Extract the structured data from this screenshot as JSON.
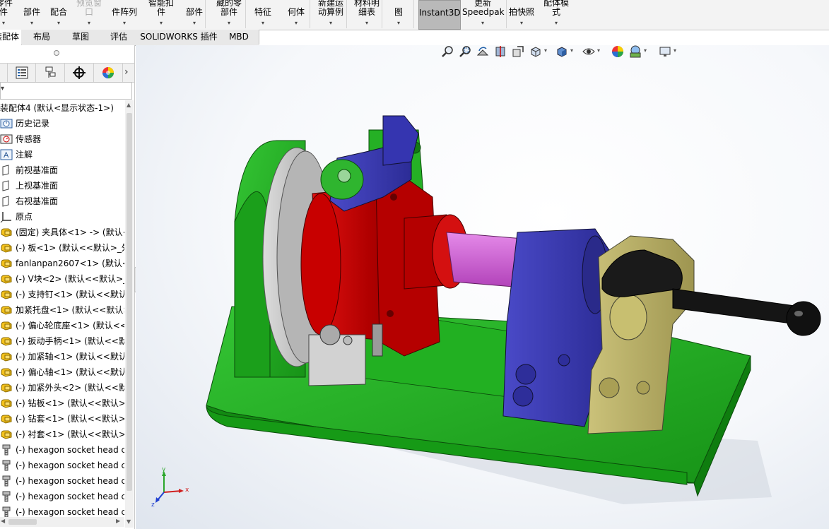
{
  "ribbon": {
    "buttons": [
      {
        "label": "零件\n件"
      },
      {
        "label": "部件"
      },
      {
        "label": "配合"
      },
      {
        "label": "零部件\n预览窗\n口",
        "dim": true
      },
      {
        "label": "件阵列"
      },
      {
        "label": "智能扣\n件"
      },
      {
        "label": "部件"
      },
      {
        "label": "显示隐\n藏的零\n部件"
      },
      {
        "label": "特征"
      },
      {
        "label": "何体"
      },
      {
        "label": "新建运\n动算例"
      },
      {
        "label": "材料明\n细表"
      },
      {
        "label": "图"
      },
      {
        "label": "Instant3D",
        "selected": true
      },
      {
        "label": "更新\nSpeedpak"
      },
      {
        "label": "拍快照"
      },
      {
        "label": "大型装\n配体模\n式"
      }
    ]
  },
  "tabs": [
    {
      "label": "装配体",
      "active": true
    },
    {
      "label": "布局"
    },
    {
      "label": "草图"
    },
    {
      "label": "评估"
    },
    {
      "label": "SOLIDWORKS 插件"
    },
    {
      "label": "MBD"
    }
  ],
  "tree": {
    "root": "装配体4  (默认<显示状态-1>)",
    "items": [
      {
        "label": "历史记录",
        "icon": "history-icon"
      },
      {
        "label": "传感器",
        "icon": "sensor-icon"
      },
      {
        "label": "注解",
        "icon": "annotation-icon"
      },
      {
        "label": "前视基准面",
        "icon": "plane-icon"
      },
      {
        "label": "上视基准面",
        "icon": "plane-icon"
      },
      {
        "label": "右视基准面",
        "icon": "plane-icon"
      },
      {
        "label": "原点",
        "icon": "origin-icon"
      },
      {
        "label": "(固定) 夹具体<1> -> (默认<",
        "icon": "part-icon"
      },
      {
        "label": "(-) 板<1> (默认<<默认>_外",
        "icon": "part-icon"
      },
      {
        "label": "fanlanpan2607<1> (默认<",
        "icon": "part-icon"
      },
      {
        "label": "(-) V块<2> (默认<<默认>_",
        "icon": "part-icon"
      },
      {
        "label": "(-) 支持钉<1> (默认<<默认",
        "icon": "part-icon"
      },
      {
        "label": "加紧托盘<1> (默认<<默认>",
        "icon": "part-icon"
      },
      {
        "label": "(-) 偏心轮底座<1> (默认<<",
        "icon": "part-icon"
      },
      {
        "label": "(-) 扳动手柄<1> (默认<<默",
        "icon": "part-icon"
      },
      {
        "label": "(-) 加紧轴<1> (默认<<默认",
        "icon": "part-icon"
      },
      {
        "label": "(-) 偏心轴<1> (默认<<默认",
        "icon": "part-icon"
      },
      {
        "label": "(-) 加紧外头<2> (默认<<默",
        "icon": "part-icon"
      },
      {
        "label": "(-) 钻板<1> (默认<<默认>_",
        "icon": "part-icon"
      },
      {
        "label": "(-) 钻套<1> (默认<<默认>_",
        "icon": "part-icon"
      },
      {
        "label": "(-) 衬套<1> (默认<<默认>_",
        "icon": "part-icon"
      },
      {
        "label": "(-) hexagon socket head c",
        "icon": "screw-icon"
      },
      {
        "label": "(-) hexagon socket head c",
        "icon": "screw-icon"
      },
      {
        "label": "(-) hexagon socket head c",
        "icon": "screw-icon"
      },
      {
        "label": "(-) hexagon socket head c",
        "icon": "screw-icon"
      },
      {
        "label": "(-) hexagon socket head c",
        "icon": "screw-icon"
      }
    ]
  },
  "triad": {
    "x": "x",
    "y": "y",
    "z": "z"
  },
  "colors": {
    "base_green": "#1fae1f",
    "red": "#c40000",
    "blue": "#3c3cb4",
    "olive": "#bdb45a",
    "pink": "#d060d8",
    "gray": "#c8c8c8"
  }
}
